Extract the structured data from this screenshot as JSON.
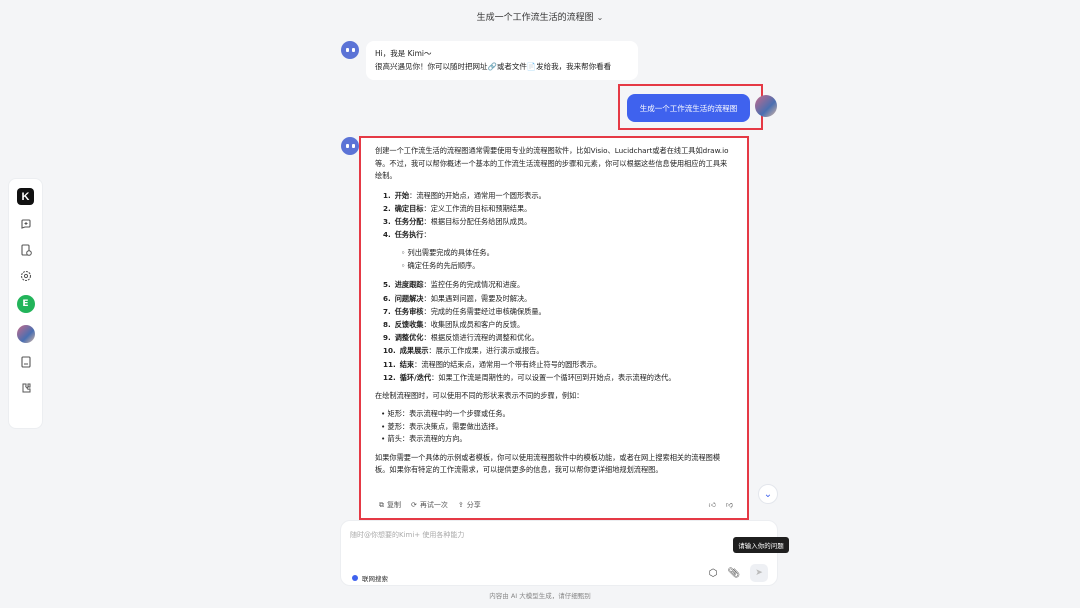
{
  "header": {
    "title": "生成一个工作流生活的流程图"
  },
  "rail": {
    "logo": "K",
    "icons": [
      "new-chat-icon",
      "history-icon",
      "settings-icon",
      "app-icon",
      "avatar",
      "doc-icon",
      "plugin-icon"
    ],
    "green_label": "E"
  },
  "greeting": {
    "line1": "Hi，我是 Kimi～",
    "line2": "很高兴遇见你！你可以随时把网址🔗或者文件📄发给我，我来帮你看看"
  },
  "user_message": "生成一个工作流生活的流程图",
  "answer": {
    "intro": "创建一个工作流生活的流程图通常需要使用专业的流程图软件，比如Visio、Lucidchart或者在线工具如draw.io等。不过，我可以帮你概述一个基本的工作流生活流程图的步骤和元素，你可以根据这些信息使用相应的工具来绘制。",
    "steps": [
      {
        "n": "1.",
        "title": "开始",
        "text": "：流程图的开始点，通常用一个圆形表示。"
      },
      {
        "n": "2.",
        "title": "确定目标",
        "text": "：定义工作流的目标和预期结果。"
      },
      {
        "n": "3.",
        "title": "任务分配",
        "text": "：根据目标分配任务给团队成员。"
      },
      {
        "n": "4.",
        "title": "任务执行",
        "text": "："
      }
    ],
    "substeps": [
      "列出需要完成的具体任务。",
      "确定任务的先后顺序。"
    ],
    "steps2": [
      {
        "n": "5.",
        "title": "进度跟踪",
        "text": "：监控任务的完成情况和进度。"
      },
      {
        "n": "6.",
        "title": "问题解决",
        "text": "：如果遇到问题，需要及时解决。"
      },
      {
        "n": "7.",
        "title": "任务审核",
        "text": "：完成的任务需要经过审核确保质量。"
      },
      {
        "n": "8.",
        "title": "反馈收集",
        "text": "：收集团队成员和客户的反馈。"
      },
      {
        "n": "9.",
        "title": "调整优化",
        "text": "：根据反馈进行流程的调整和优化。"
      },
      {
        "n": "10.",
        "title": "成果展示",
        "text": "：展示工作成果，进行演示或报告。"
      },
      {
        "n": "11.",
        "title": "结束",
        "text": "：流程图的结束点，通常用一个带有终止符号的圆形表示。"
      },
      {
        "n": "12.",
        "title": "循环/迭代",
        "text": "：如果工作流是周期性的，可以设置一个循环回到开始点，表示流程的迭代。"
      }
    ],
    "shapes_intro": "在绘制流程图时，可以使用不同的形状来表示不同的步骤，例如：",
    "shapes": [
      "矩形：表示流程中的一个步骤或任务。",
      "菱形：表示决策点，需要做出选择。",
      "箭头：表示流程的方向。"
    ],
    "outro": "如果你需要一个具体的示例或者模板，你可以使用流程图软件中的模板功能，或者在网上搜索相关的流程图模板。如果你有特定的工作流需求，可以提供更多的信息，我可以帮你更详细地规划流程图。",
    "actions": {
      "copy": "复制",
      "retry": "再试一次",
      "share": "分享"
    }
  },
  "input": {
    "placeholder": "随时@你想要的Kimi+ 使用各种能力",
    "web_search": "联网搜索",
    "tooltip": "请输入你的问题"
  },
  "footer": "内容由 AI 大模型生成，请仔细甄别"
}
